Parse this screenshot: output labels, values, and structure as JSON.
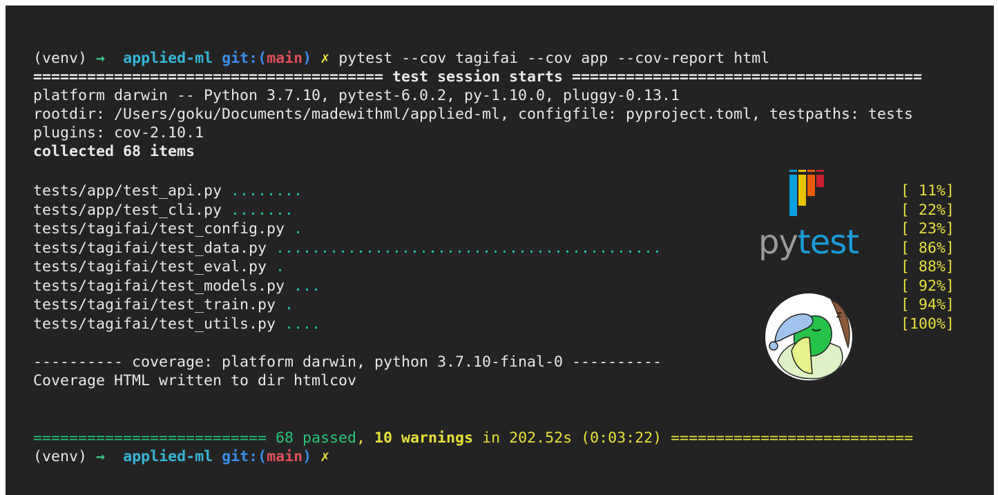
{
  "prompt1": {
    "venv": "(venv)",
    "arrow": "→",
    "dir": "applied-ml",
    "git_label": "git:(",
    "branch": "main",
    "git_close": ")",
    "dirty": "✗",
    "command": "pytest --cov tagifai --cov app --cov-report html"
  },
  "session": {
    "rule_left": "=======================================",
    "header": " test session starts ",
    "rule_right": "=======================================",
    "platform": "platform darwin -- Python 3.7.10, pytest-6.0.2, py-1.10.0, pluggy-0.13.1",
    "rootdir": "rootdir: /Users/goku/Documents/madewithml/applied-ml, configfile: pyproject.toml, testpaths: tests",
    "plugins": "plugins: cov-2.10.1",
    "collected": "collected 68 items"
  },
  "tests": [
    {
      "file": "tests/app/test_api.py",
      "dots": "........",
      "pct": "[ 11%]"
    },
    {
      "file": "tests/app/test_cli.py",
      "dots": ".......",
      "pct": "[ 22%]"
    },
    {
      "file": "tests/tagifai/test_config.py",
      "dots": ".",
      "pct": "[ 23%]"
    },
    {
      "file": "tests/tagifai/test_data.py",
      "dots": "...........................................",
      "pct": "[ 86%]"
    },
    {
      "file": "tests/tagifai/test_eval.py",
      "dots": ".",
      "pct": "[ 88%]"
    },
    {
      "file": "tests/tagifai/test_models.py",
      "dots": "...",
      "pct": "[ 92%]"
    },
    {
      "file": "tests/tagifai/test_train.py",
      "dots": ".",
      "pct": "[ 94%]"
    },
    {
      "file": "tests/tagifai/test_utils.py",
      "dots": "....",
      "pct": "[100%]"
    }
  ],
  "coverage": {
    "header": "---------- coverage: platform darwin, python 3.7.10-final-0 ----------",
    "written": "Coverage HTML written to dir htmlcov"
  },
  "summary": {
    "rule_left": "==========================",
    "passed": " 68 passed",
    "comma": ",",
    "warnings": " 10 warnings",
    "timing": " in 202.52s (0:03:22) ",
    "rule_right": "==========================="
  },
  "prompt2": {
    "venv": "(venv)",
    "arrow": "→",
    "dir": "applied-ml",
    "git_label": "git:(",
    "branch": "main",
    "git_close": ")",
    "dirty": "✗"
  },
  "logo": {
    "text_py": "py",
    "text_test": "test",
    "bar_colors": [
      "#0a9edc",
      "#e8c400",
      "#e85d00",
      "#c81e2e"
    ],
    "name": "pytest-logo"
  },
  "colors": {
    "background": "#232323",
    "prompt_dir": "#35b6d6",
    "branch": "#e0505a",
    "success": "#25c77a",
    "warning": "#e7e23a"
  }
}
